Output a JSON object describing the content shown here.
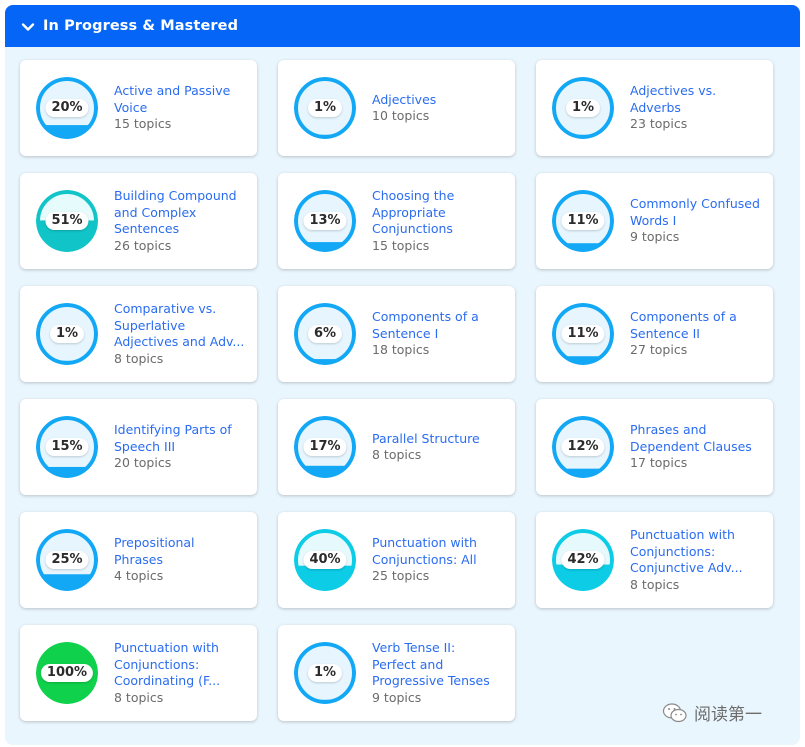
{
  "section": {
    "title": "In Progress & Mastered",
    "icon": "chevron-down-icon",
    "expanded": true
  },
  "colors": {
    "header_bg": "#0565f7",
    "panel_bg": "#eaf6fe",
    "link": "#2a6cf0",
    "low_progress": "#12a8f5",
    "mid_progress": "#11c4c7",
    "high_progress": "#0ccce6",
    "mastered": "#0fd14b"
  },
  "skills": [
    {
      "name_lines": [
        "Active and Passive",
        "Voice"
      ],
      "topics": "15 topics",
      "percent": 20,
      "percent_label": "20%",
      "tier": "low"
    },
    {
      "name_lines": [
        "Adjectives"
      ],
      "topics": "10 topics",
      "percent": 1,
      "percent_label": "1%",
      "tier": "low"
    },
    {
      "name_lines": [
        "Adjectives vs.",
        "Adverbs"
      ],
      "topics": "23 topics",
      "percent": 1,
      "percent_label": "1%",
      "tier": "low"
    },
    {
      "name_lines": [
        "Building Compound",
        "and Complex",
        "Sentences"
      ],
      "topics": "26 topics",
      "percent": 51,
      "percent_label": "51%",
      "tier": "mid"
    },
    {
      "name_lines": [
        "Choosing the",
        "Appropriate",
        "Conjunctions"
      ],
      "topics": "15 topics",
      "percent": 13,
      "percent_label": "13%",
      "tier": "low"
    },
    {
      "name_lines": [
        "Commonly Confused",
        "Words I"
      ],
      "topics": "9 topics",
      "percent": 11,
      "percent_label": "11%",
      "tier": "low"
    },
    {
      "name_lines": [
        "Comparative vs.",
        "Superlative",
        "Adjectives and Adv..."
      ],
      "topics": "8 topics",
      "percent": 1,
      "percent_label": "1%",
      "tier": "low"
    },
    {
      "name_lines": [
        "Components of a",
        "Sentence I"
      ],
      "topics": "18 topics",
      "percent": 6,
      "percent_label": "6%",
      "tier": "low"
    },
    {
      "name_lines": [
        "Components of a",
        "Sentence II"
      ],
      "topics": "27 topics",
      "percent": 11,
      "percent_label": "11%",
      "tier": "low"
    },
    {
      "name_lines": [
        "Identifying Parts of",
        "Speech III"
      ],
      "topics": "20 topics",
      "percent": 15,
      "percent_label": "15%",
      "tier": "low"
    },
    {
      "name_lines": [
        "Parallel Structure"
      ],
      "topics": "8 topics",
      "percent": 17,
      "percent_label": "17%",
      "tier": "low"
    },
    {
      "name_lines": [
        "Phrases and",
        "Dependent Clauses"
      ],
      "topics": "17 topics",
      "percent": 12,
      "percent_label": "12%",
      "tier": "low"
    },
    {
      "name_lines": [
        "Prepositional",
        "Phrases"
      ],
      "topics": "4 topics",
      "percent": 25,
      "percent_label": "25%",
      "tier": "low"
    },
    {
      "name_lines": [
        "Punctuation with",
        "Conjunctions: All"
      ],
      "topics": "25 topics",
      "percent": 40,
      "percent_label": "40%",
      "tier": "high"
    },
    {
      "name_lines": [
        "Punctuation with",
        "Conjunctions:",
        "Conjunctive Adv..."
      ],
      "topics": "8 topics",
      "percent": 42,
      "percent_label": "42%",
      "tier": "high"
    },
    {
      "name_lines": [
        "Punctuation with",
        "Conjunctions:",
        "Coordinating (F..."
      ],
      "topics": "8 topics",
      "percent": 100,
      "percent_label": "100%",
      "tier": "mastered"
    },
    {
      "name_lines": [
        "Verb Tense II:",
        "Perfect and",
        "Progressive Tenses"
      ],
      "topics": "9 topics",
      "percent": 1,
      "percent_label": "1%",
      "tier": "low"
    }
  ],
  "watermark": {
    "icon": "wechat-icon",
    "text": "阅读第一"
  }
}
